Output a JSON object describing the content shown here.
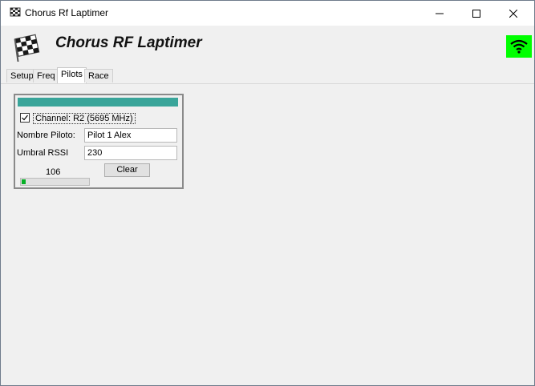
{
  "window": {
    "title": "Chorus Rf Laptimer"
  },
  "header": {
    "title": "Chorus RF Laptimer",
    "wifi_color": "#00ff00"
  },
  "tabs": [
    {
      "label": "Setup"
    },
    {
      "label": "Freq"
    },
    {
      "label": "Pilots"
    },
    {
      "label": "Race"
    }
  ],
  "active_tab": "Pilots",
  "pilot_panel": {
    "header_bar_color": "#3aa59a",
    "channel_checked": true,
    "channel_label": "Channel: R2 (5695 MHz)",
    "pilot_name_label": "Nombre Piloto:",
    "pilot_name_value": "Pilot 1 Alex",
    "rssi_threshold_label": "Umbral RSSI",
    "rssi_threshold_value": "230",
    "current_rssi": "106",
    "rssi_meter_level": 0.06,
    "clear_label": "Clear"
  }
}
